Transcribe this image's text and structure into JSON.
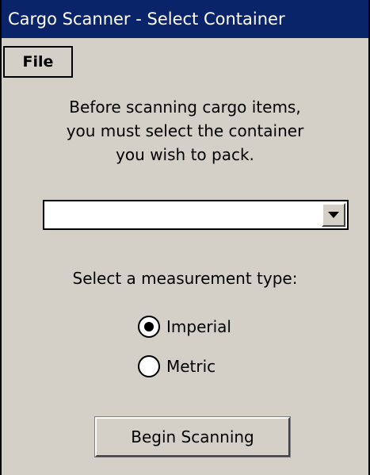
{
  "window": {
    "title": "Cargo Scanner - Select Container"
  },
  "menu": {
    "file_label": "File"
  },
  "instructions": {
    "line1": "Before scanning cargo items,",
    "line2": "you must select the container",
    "line3": "you wish to pack."
  },
  "container_select": {
    "value": ""
  },
  "measurement": {
    "label": "Select a measurement type:",
    "options": [
      {
        "label": "Imperial",
        "selected": true
      },
      {
        "label": "Metric",
        "selected": false
      }
    ]
  },
  "actions": {
    "begin_label": "Begin Scanning"
  },
  "colors": {
    "titlebar": "#0a246a",
    "window_bg": "#d4d0c8"
  }
}
